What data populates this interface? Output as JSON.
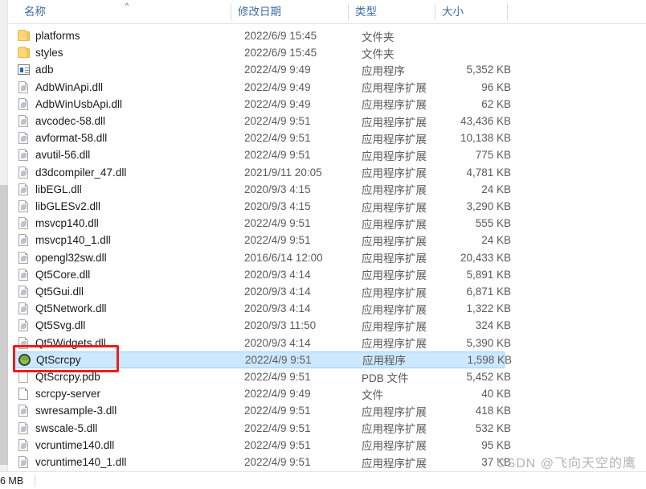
{
  "window": {
    "title": "File Explorer file list"
  },
  "columns": {
    "name": "名称",
    "date_modified": "修改日期",
    "type": "类型",
    "size": "大小",
    "sort_caret": "^"
  },
  "scrollbar": {
    "down_arrow": "⌄"
  },
  "files": [
    {
      "name": "platforms",
      "date": "2022/6/9 15:45",
      "type": "文件夹",
      "size": "",
      "icon": "folder-icon"
    },
    {
      "name": "styles",
      "date": "2022/6/9 15:45",
      "type": "文件夹",
      "size": "",
      "icon": "folder-icon"
    },
    {
      "name": "adb",
      "date": "2022/4/9 9:49",
      "type": "应用程序",
      "size": "5,352 KB",
      "icon": "application-icon"
    },
    {
      "name": "AdbWinApi.dll",
      "date": "2022/4/9 9:49",
      "type": "应用程序扩展",
      "size": "96 KB",
      "icon": "dll-icon"
    },
    {
      "name": "AdbWinUsbApi.dll",
      "date": "2022/4/9 9:49",
      "type": "应用程序扩展",
      "size": "62 KB",
      "icon": "dll-icon"
    },
    {
      "name": "avcodec-58.dll",
      "date": "2022/4/9 9:51",
      "type": "应用程序扩展",
      "size": "43,436 KB",
      "icon": "dll-icon"
    },
    {
      "name": "avformat-58.dll",
      "date": "2022/4/9 9:51",
      "type": "应用程序扩展",
      "size": "10,138 KB",
      "icon": "dll-icon"
    },
    {
      "name": "avutil-56.dll",
      "date": "2022/4/9 9:51",
      "type": "应用程序扩展",
      "size": "775 KB",
      "icon": "dll-icon"
    },
    {
      "name": "d3dcompiler_47.dll",
      "date": "2021/9/11 20:05",
      "type": "应用程序扩展",
      "size": "4,781 KB",
      "icon": "dll-icon"
    },
    {
      "name": "libEGL.dll",
      "date": "2020/9/3 4:15",
      "type": "应用程序扩展",
      "size": "24 KB",
      "icon": "dll-icon"
    },
    {
      "name": "libGLESv2.dll",
      "date": "2020/9/3 4:15",
      "type": "应用程序扩展",
      "size": "3,290 KB",
      "icon": "dll-icon"
    },
    {
      "name": "msvcp140.dll",
      "date": "2022/4/9 9:51",
      "type": "应用程序扩展",
      "size": "555 KB",
      "icon": "dll-icon"
    },
    {
      "name": "msvcp140_1.dll",
      "date": "2022/4/9 9:51",
      "type": "应用程序扩展",
      "size": "24 KB",
      "icon": "dll-icon"
    },
    {
      "name": "opengl32sw.dll",
      "date": "2016/6/14 12:00",
      "type": "应用程序扩展",
      "size": "20,433 KB",
      "icon": "dll-icon"
    },
    {
      "name": "Qt5Core.dll",
      "date": "2020/9/3 4:14",
      "type": "应用程序扩展",
      "size": "5,891 KB",
      "icon": "dll-icon"
    },
    {
      "name": "Qt5Gui.dll",
      "date": "2020/9/3 4:14",
      "type": "应用程序扩展",
      "size": "6,871 KB",
      "icon": "dll-icon"
    },
    {
      "name": "Qt5Network.dll",
      "date": "2020/9/3 4:14",
      "type": "应用程序扩展",
      "size": "1,322 KB",
      "icon": "dll-icon"
    },
    {
      "name": "Qt5Svg.dll",
      "date": "2020/9/3 11:50",
      "type": "应用程序扩展",
      "size": "324 KB",
      "icon": "dll-icon"
    },
    {
      "name": "Qt5Widgets.dll",
      "date": "2020/9/3 4:14",
      "type": "应用程序扩展",
      "size": "5,390 KB",
      "icon": "dll-icon"
    },
    {
      "name": "QtScrcpy",
      "date": "2022/4/9 9:51",
      "type": "应用程序",
      "size": "1,598 KB",
      "icon": "android-app-icon",
      "selected": true
    },
    {
      "name": "QtScrcpy.pdb",
      "date": "2022/4/9 9:51",
      "type": "PDB 文件",
      "size": "5,452 KB",
      "icon": "blank-file-icon"
    },
    {
      "name": "scrcpy-server",
      "date": "2022/4/9 9:49",
      "type": "文件",
      "size": "40 KB",
      "icon": "plain-file-icon"
    },
    {
      "name": "swresample-3.dll",
      "date": "2022/4/9 9:51",
      "type": "应用程序扩展",
      "size": "418 KB",
      "icon": "dll-icon"
    },
    {
      "name": "swscale-5.dll",
      "date": "2022/4/9 9:51",
      "type": "应用程序扩展",
      "size": "532 KB",
      "icon": "dll-icon"
    },
    {
      "name": "vcruntime140.dll",
      "date": "2022/4/9 9:51",
      "type": "应用程序扩展",
      "size": "95 KB",
      "icon": "dll-icon"
    },
    {
      "name": "vcruntime140_1.dll",
      "date": "2022/4/9 9:51",
      "type": "应用程序扩展",
      "size": "37 KB",
      "icon": "dll-icon"
    }
  ],
  "status_bar": {
    "total_size": "6 MB"
  },
  "annotation": {
    "color": "#ee1c1c",
    "target": "QtScrcpy"
  },
  "watermark": {
    "text": "CSDN @飞向天空的鹰"
  }
}
